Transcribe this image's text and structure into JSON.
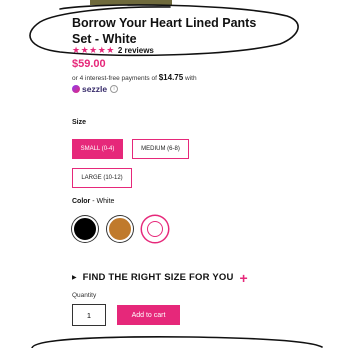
{
  "product": {
    "title": "Borrow Your Heart Lined Pants Set - White",
    "stars": "★★★★★",
    "rating": 5,
    "reviews": "2 reviews",
    "price": "$59.00"
  },
  "installments": {
    "prefix": "or 4 interest-free payments of",
    "amount": "$14.75",
    "suffix": "with",
    "provider": "sezzle",
    "info_glyph": "i"
  },
  "size": {
    "label": "Size",
    "options": [
      "SMALL (0-4)",
      "MEDIUM (6-8)",
      "LARGE (10-12)"
    ],
    "selected": "SMALL (0-4)"
  },
  "color": {
    "label": "Color",
    "separator": " - ",
    "selected": "White",
    "swatches": [
      {
        "name": "black",
        "hex": "#000000"
      },
      {
        "name": "brown",
        "hex": "#c07a2c"
      },
      {
        "name": "white",
        "hex": "#ffffff"
      }
    ]
  },
  "fit_guide": {
    "caret": "▶",
    "label": "FIND THE RIGHT SIZE FOR YOU",
    "plus": "+"
  },
  "quantity": {
    "label": "Quantity",
    "value": "1"
  },
  "cart": {
    "button_label": "Add to cart"
  },
  "colors": {
    "accent": "#e6287a"
  }
}
